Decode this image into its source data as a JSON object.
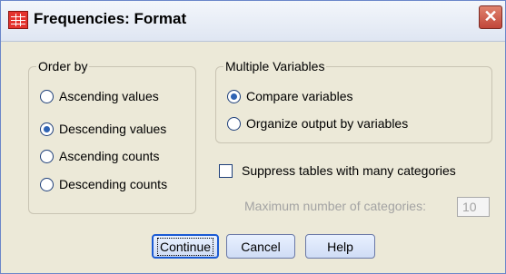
{
  "window": {
    "title": "Frequencies: Format",
    "close_icon": "close-icon",
    "app_icon": "spss-table-icon"
  },
  "order_by": {
    "title": "Order by",
    "options": [
      {
        "label": "Ascending values",
        "checked": false
      },
      {
        "label": "Descending values",
        "checked": true
      },
      {
        "label": "Ascending counts",
        "checked": false
      },
      {
        "label": "Descending counts",
        "checked": false
      }
    ]
  },
  "multiple_variables": {
    "title": "Multiple Variables",
    "options": [
      {
        "label": "Compare variables",
        "checked": true
      },
      {
        "label": "Organize output by variables",
        "checked": false
      }
    ]
  },
  "suppress": {
    "label": "Suppress tables with many categories",
    "checked": false,
    "max_label": "Maximum number of categories:",
    "max_value": "10"
  },
  "buttons": {
    "continue": "Continue",
    "cancel": "Cancel",
    "help": "Help"
  }
}
